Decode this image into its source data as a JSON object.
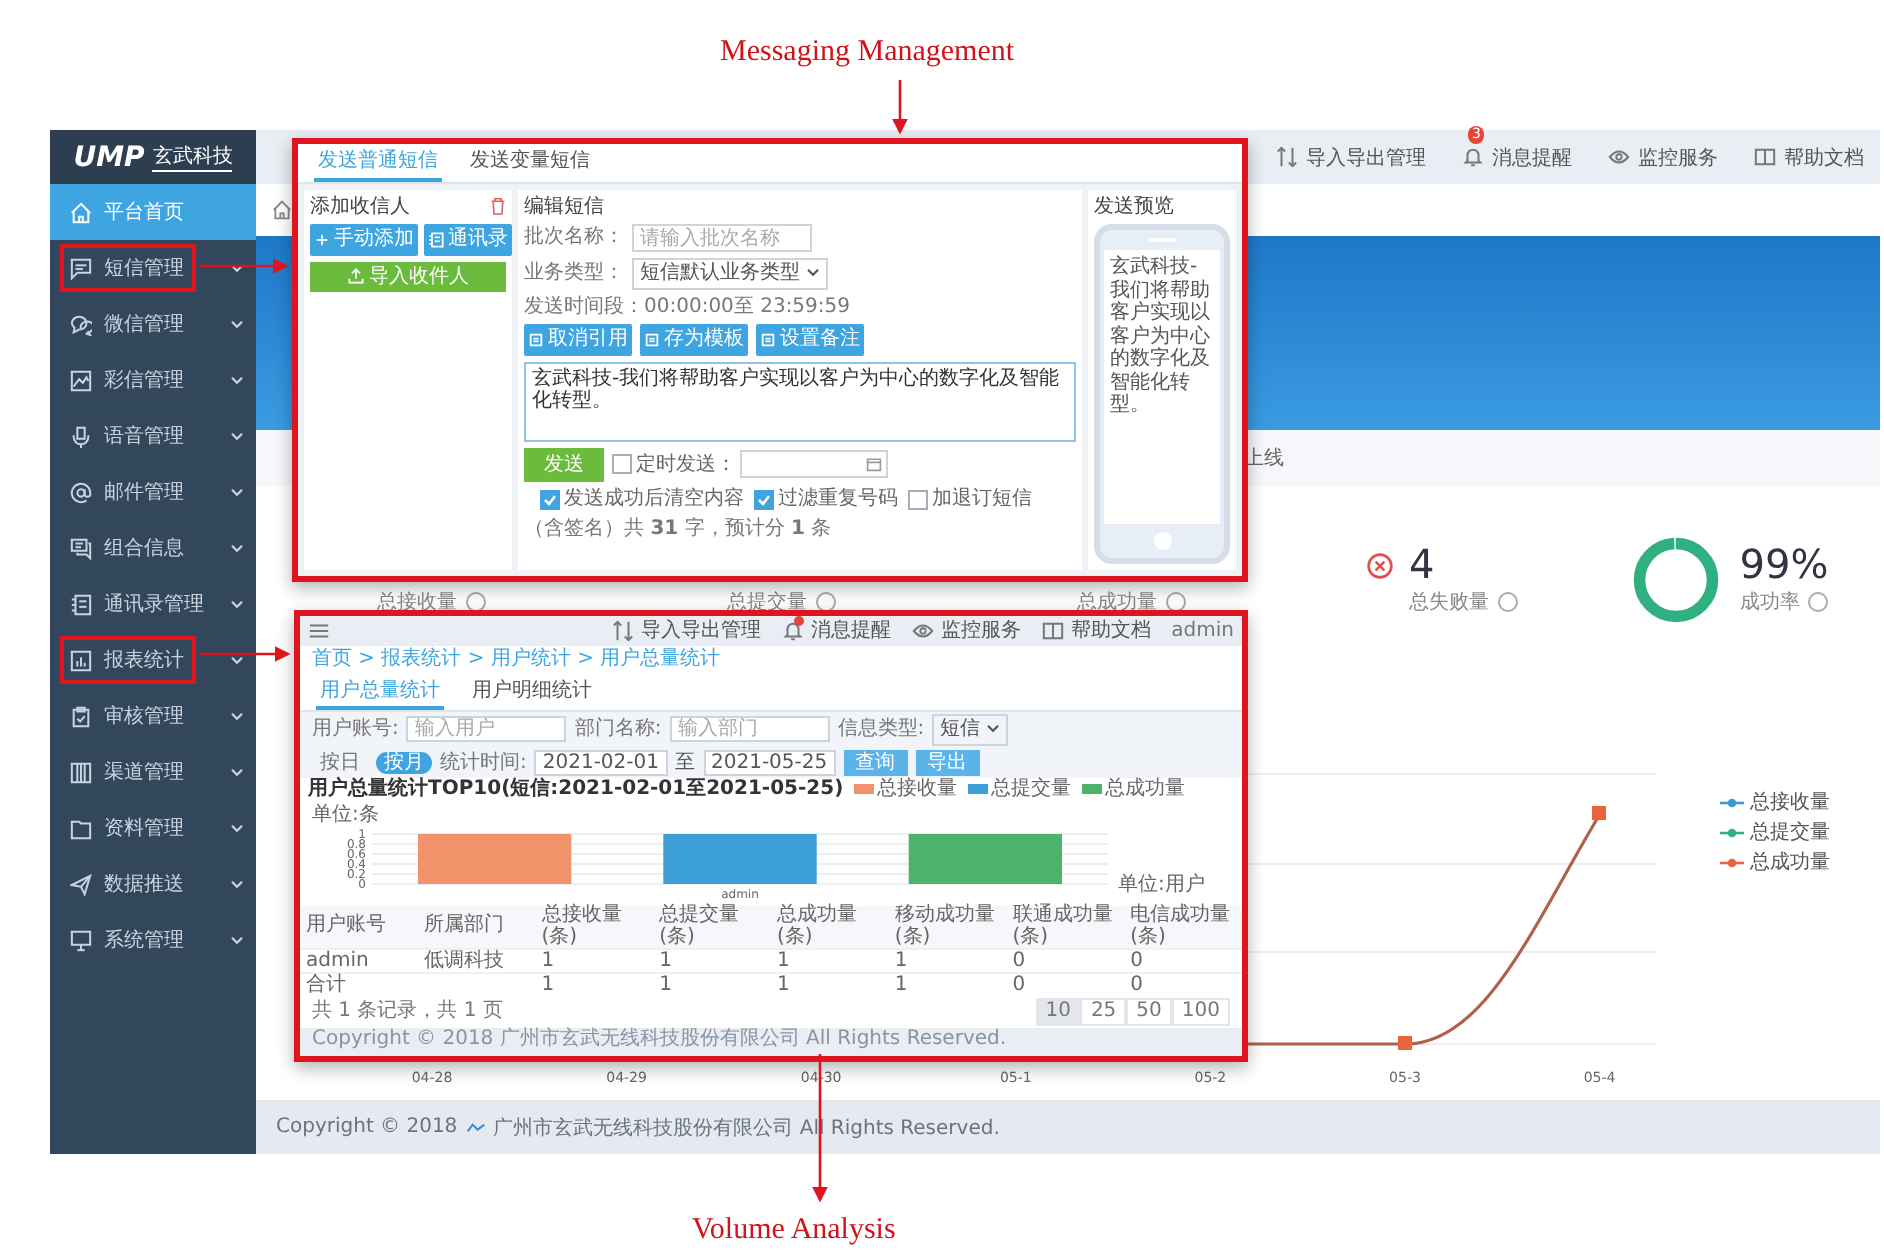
{
  "figure": {
    "top_caption": "Messaging Management",
    "bottom_caption": "Volume Analysis"
  },
  "sidebar": {
    "logo": "UMP",
    "logo_sub": "玄武科技",
    "items": [
      {
        "label": "平台首页",
        "selected": true,
        "highlighted": false
      },
      {
        "label": "短信管理",
        "selected": false,
        "highlighted": true
      },
      {
        "label": "微信管理",
        "selected": false,
        "highlighted": false
      },
      {
        "label": "彩信管理",
        "selected": false,
        "highlighted": false
      },
      {
        "label": "语音管理",
        "selected": false,
        "highlighted": false
      },
      {
        "label": "邮件管理",
        "selected": false,
        "highlighted": false
      },
      {
        "label": "组合信息",
        "selected": false,
        "highlighted": false
      },
      {
        "label": "通讯录管理",
        "selected": false,
        "highlighted": false
      },
      {
        "label": "报表统计",
        "selected": false,
        "highlighted": true
      },
      {
        "label": "审核管理",
        "selected": false,
        "highlighted": false
      },
      {
        "label": "渠道管理",
        "selected": false,
        "highlighted": false
      },
      {
        "label": "资料管理",
        "selected": false,
        "highlighted": false
      },
      {
        "label": "数据推送",
        "selected": false,
        "highlighted": false
      },
      {
        "label": "系统管理",
        "selected": false,
        "highlighted": false
      }
    ]
  },
  "top_bar": [
    {
      "label": "导入导出管理"
    },
    {
      "label": "消息提醒",
      "badge": "3"
    },
    {
      "label": "监控服务"
    },
    {
      "label": "帮助文档"
    }
  ],
  "banner_caption": "上线",
  "stats": [
    {
      "kind": "plain",
      "label": "总接收量"
    },
    {
      "kind": "plain",
      "label": "总提交量"
    },
    {
      "kind": "plain",
      "label": "总成功量"
    },
    {
      "kind": "failure",
      "value": "4",
      "label": "总失败量"
    },
    {
      "kind": "rate",
      "value": "99%",
      "label": "成功率",
      "level": 0.99
    }
  ],
  "trend_chart": {
    "legend": [
      {
        "label": "总接收量",
        "color": "#3a9ad9"
      },
      {
        "label": "总提交量",
        "color": "#2fb08a"
      },
      {
        "label": "总成功量",
        "color": "#e8643c"
      }
    ],
    "x_labels": [
      "04-28",
      "04-29",
      "04-30",
      "05-1",
      "05-2",
      "05-3",
      "05-4"
    ]
  },
  "footer": {
    "copyright": "Copyright © 2018",
    "company": "广州市玄武无线科技股份有限公司 All Rights Reserved."
  },
  "messaging_inset": {
    "tabs": [
      {
        "label": "发送普通短信",
        "selected": true
      },
      {
        "label": "发送变量短信",
        "selected": false
      }
    ],
    "recipients": {
      "title": "添加收信人",
      "buttons": [
        {
          "label": "手动添加",
          "kind": "add"
        },
        {
          "label": "通讯录",
          "kind": "contacts"
        }
      ],
      "import_button": "导入收件人"
    },
    "editor": {
      "title": "编辑短信",
      "batch_label": "批次名称：",
      "batch_placeholder": "请输入批次名称",
      "type_label": "业务类型：",
      "type_value": "短信默认业务类型",
      "time_range": "发送时间段：00:00:00至 23:59:59",
      "tools": [
        {
          "label": "取消引用"
        },
        {
          "label": "存为模板"
        },
        {
          "label": "设置备注"
        }
      ],
      "content": "玄武科技-我们将帮助客户实现以客户为中心的数字化及智能化转型。",
      "send_button": "发送",
      "options": [
        {
          "label": "定时发送：",
          "checked": false,
          "kind": "schedule"
        },
        {
          "label": "发送成功后清空内容",
          "checked": true,
          "kind": "plain"
        },
        {
          "label": "过滤重复号码",
          "checked": true,
          "kind": "plain"
        },
        {
          "label": "加退订短信",
          "checked": false,
          "kind": "plain"
        }
      ],
      "count_note": "（含签名）共 **31** 字，预计分 **1** 条"
    },
    "preview": {
      "title": "发送预览",
      "text": "玄武科技-我们将帮助客户实现以客户为中心的数字化及智能化转型。"
    }
  },
  "volume_inset": {
    "top_bar": [
      {
        "label": "导入导出管理",
        "badge": false
      },
      {
        "label": "消息提醒",
        "badge": true
      },
      {
        "label": "监控服务",
        "badge": false
      },
      {
        "label": "帮助文档",
        "badge": false
      }
    ],
    "user": "admin",
    "breadcrumb": "首页 > 报表统计 > 用户统计 > 用户总量统计",
    "tabs": [
      {
        "label": "用户总量统计",
        "selected": true
      },
      {
        "label": "用户明细统计",
        "selected": false
      }
    ],
    "filters": [
      {
        "label": "用户账号:",
        "placeholder": "输入用户",
        "kind": "input"
      },
      {
        "label": "部门名称:",
        "placeholder": "输入部门",
        "kind": "input"
      },
      {
        "label": "信息类型:",
        "value": "短信",
        "kind": "select"
      }
    ],
    "period_toggle": [
      {
        "label": "按日",
        "selected": false
      },
      {
        "label": "按月",
        "selected": true
      }
    ],
    "date_label": "统计时间:",
    "date_from": "2021-02-01",
    "date_sep": "至",
    "date_to": "2021-05-25",
    "query_button": "查询",
    "export_button": "导出",
    "chart_data": {
      "type": "bar",
      "title": "用户总量统计TOP10(短信:2021-02-01至2021-05-25)",
      "ylabel": "单位:条",
      "xlabel": "单位:用户",
      "categories": [
        "admin"
      ],
      "series": [
        {
          "name": "总接收量",
          "color": "#f0926a",
          "values": [
            1
          ]
        },
        {
          "name": "总提交量",
          "color": "#3c9fd6",
          "values": [
            1
          ]
        },
        {
          "name": "总成功量",
          "color": "#4db36a",
          "values": [
            1
          ]
        }
      ],
      "ylim": [
        0,
        1
      ],
      "yticks": [
        0,
        0.2,
        0.4,
        0.6,
        0.8,
        1
      ],
      "grid": true,
      "legend": "top"
    },
    "table": {
      "columns": [
        "用户账号",
        "所属部门",
        "总接收量(条)",
        "总提交量(条)",
        "总成功量(条)",
        "移动成功量(条)",
        "联通成功量(条)",
        "电信成功量(条)"
      ],
      "rows": [
        {
          "account": "admin",
          "department": "低调科技",
          "values": [
            "1",
            "1",
            "1",
            "1",
            "0",
            "0"
          ]
        },
        {
          "account": "合计",
          "values": [
            "1",
            "1",
            "1",
            "1",
            "0",
            "0"
          ]
        }
      ]
    },
    "pagination": {
      "summary": "共 1 条记录，共 1 页",
      "page_sizes": [
        {
          "label": "10",
          "selected": true
        },
        {
          "label": "25",
          "selected": false
        },
        {
          "label": "50",
          "selected": false
        },
        {
          "label": "100",
          "selected": false
        }
      ]
    },
    "footer": "Copyright © 2018 广州市玄武无线科技股份有限公司 All Rights Reserved."
  }
}
